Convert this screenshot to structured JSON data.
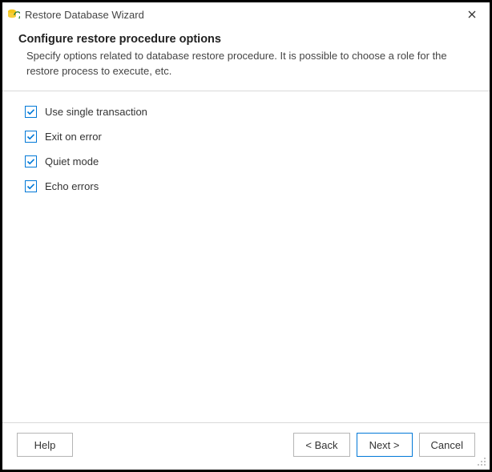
{
  "window": {
    "title": "Restore Database Wizard"
  },
  "header": {
    "heading": "Configure restore procedure options",
    "description": "Specify options related to database restore procedure. It is possible to choose a role for the restore process to execute, etc."
  },
  "options": {
    "use_single_transaction": {
      "label": "Use single transaction",
      "checked": true
    },
    "exit_on_error": {
      "label": "Exit on error",
      "checked": true
    },
    "quiet_mode": {
      "label": "Quiet mode",
      "checked": true
    },
    "echo_errors": {
      "label": "Echo errors",
      "checked": true
    }
  },
  "footer": {
    "help": "Help",
    "back": "< Back",
    "next": "Next >",
    "cancel": "Cancel"
  }
}
